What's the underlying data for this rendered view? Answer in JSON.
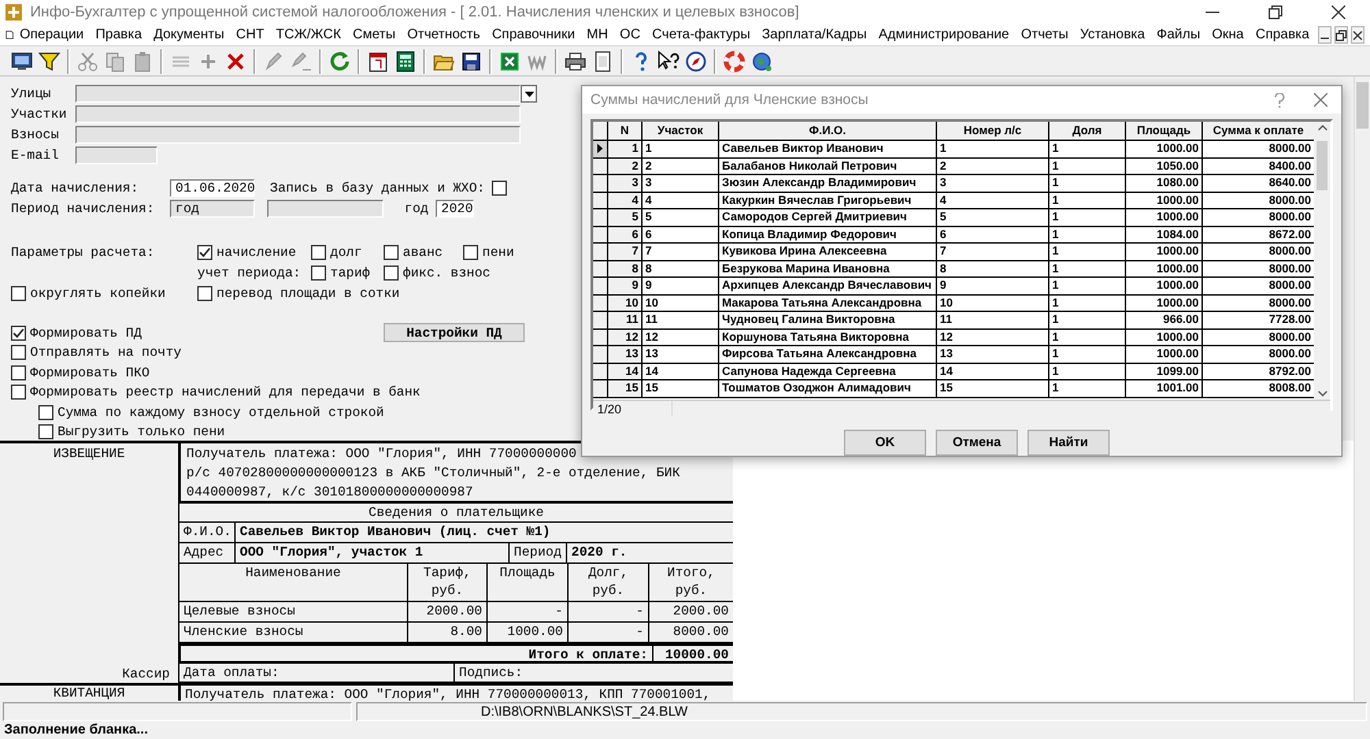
{
  "window": {
    "title": "Инфо-Бухгалтер с упрощенной системой налогообложения - [ 2.01. Начисления членских и целевых взносов]"
  },
  "menu": [
    "Операции",
    "Правка",
    "Документы",
    "СНТ",
    "ТСЖ/ЖСК",
    "Сметы",
    "Отчетность",
    "Справочники",
    "МН",
    "ОС",
    "Счета-фактуры",
    "Зарплата/Кадры",
    "Администрирование",
    "Отчеты",
    "Установка",
    "Файлы",
    "Окна",
    "Справка"
  ],
  "form": {
    "fields": [
      {
        "label": "Улицы",
        "kind": "combo"
      },
      {
        "label": "Участки",
        "kind": "text"
      },
      {
        "label": "Взносы",
        "kind": "text"
      },
      {
        "label": "E-mail",
        "kind": "short"
      }
    ],
    "accrual_date": {
      "label": "Дата начисления:",
      "value": "01.06.2020"
    },
    "db_write": {
      "label": "Запись в базу данных и ЖХО:",
      "checked": false
    },
    "period": {
      "label": "Период начисления:",
      "value": "год",
      "year_label": "год",
      "year": "2020"
    },
    "params_label": "Параметры расчета:",
    "params": [
      {
        "label": "начисление",
        "checked": true
      },
      {
        "label": "долг",
        "checked": false
      },
      {
        "label": "аванс",
        "checked": false
      },
      {
        "label": "пени",
        "checked": false
      }
    ],
    "period_account_label": "учет периода:",
    "period_account": [
      {
        "label": "тариф",
        "checked": false
      },
      {
        "label": "фикс. взнос",
        "checked": false
      }
    ],
    "extras": [
      {
        "label": "округлять копейки",
        "checked": false
      },
      {
        "label": "перевод площади в сотки",
        "checked": false
      }
    ],
    "options": [
      {
        "label": "Формировать ПД",
        "checked": true
      },
      {
        "label": "Отправлять на почту",
        "checked": false
      },
      {
        "label": "Формировать ПКО",
        "checked": false
      },
      {
        "label": "Формировать реестр начислений для передачи в банк",
        "checked": false,
        "children": [
          {
            "label": "Сумма по каждому взносу отдельной строкой",
            "checked": false
          },
          {
            "label": "Выгрузить только пени",
            "checked": false
          }
        ]
      }
    ],
    "settings_button": "Настройки ПД"
  },
  "document": {
    "notice_label": "ИЗВЕЩЕНИЕ",
    "recipient_lines": [
      "Получатель платежа: ООО \"Глория\", ИНН 77000000000",
      "р/с 40702800000000000123 в АКБ \"Столичный\", 2-е отделение, БИК",
      "0440000987, к/с 30101800000000000987"
    ],
    "payer_heading": "Сведения о плательщике",
    "fio_label": "Ф.И.О.",
    "fio": "Савельев Виктор Иванович (лиц. счет №1)",
    "address_label": "Адрес",
    "address": "ООО \"Глория\", участок 1",
    "period_label": "Период",
    "period": "2020 г.",
    "columns": [
      "Наименование",
      "Тариф, руб.",
      "Площадь",
      "Долг, руб.",
      "Итого, руб."
    ],
    "rows": [
      [
        "Целевые взносы",
        "2000.00",
        "-",
        "-",
        "2000.00"
      ],
      [
        "Членские взносы",
        "8.00",
        "1000.00",
        "-",
        "8000.00"
      ]
    ],
    "total_label": "Итого к оплате:",
    "total": "10000.00",
    "cashier_label": "Кассир",
    "payment_date_label": "Дата оплаты:",
    "signature_label": "Подпись:",
    "receipt_label": "КВИТАНЦИЯ",
    "receipt_recipient": "Получатель платежа: ООО \"Глория\", ИНН 770000000013, КПП 770001001,"
  },
  "status": {
    "path": "D:\\IB8\\ORN\\BLANKS\\ST_24.BLW",
    "message": "Заполнение бланка..."
  },
  "dialog": {
    "title": "Суммы начислений для Членские взносы",
    "columns": [
      "N",
      "Участок",
      "Ф.И.О.",
      "Номер л/с",
      "Доля",
      "Площадь",
      "Сумма к оплате"
    ],
    "rows": [
      {
        "selected": true,
        "cells": [
          "1",
          "1",
          "Савельев Виктор Иванович",
          "1",
          "1",
          "1000.00",
          "8000.00"
        ]
      },
      {
        "selected": false,
        "cells": [
          "2",
          "2",
          "Балабанов Николай Петрович",
          "2",
          "1",
          "1050.00",
          "8400.00"
        ]
      },
      {
        "selected": false,
        "cells": [
          "3",
          "3",
          "Зюзин Александр Владимирович",
          "3",
          "1",
          "1080.00",
          "8640.00"
        ]
      },
      {
        "selected": false,
        "cells": [
          "4",
          "4",
          "Какуркин Вячеслав Григорьевич",
          "4",
          "1",
          "1000.00",
          "8000.00"
        ]
      },
      {
        "selected": false,
        "cells": [
          "5",
          "5",
          "Самородов Сергей Дмитриевич",
          "5",
          "1",
          "1000.00",
          "8000.00"
        ]
      },
      {
        "selected": false,
        "cells": [
          "6",
          "6",
          "Копица Владимир Федорович",
          "6",
          "1",
          "1084.00",
          "8672.00"
        ]
      },
      {
        "selected": false,
        "cells": [
          "7",
          "7",
          "Кувикова Ирина Алексеевна",
          "7",
          "1",
          "1000.00",
          "8000.00"
        ]
      },
      {
        "selected": false,
        "cells": [
          "8",
          "8",
          "Безрукова Марина Ивановна",
          "8",
          "1",
          "1000.00",
          "8000.00"
        ]
      },
      {
        "selected": false,
        "cells": [
          "9",
          "9",
          "Архипцев Александр Вячеславович",
          "9",
          "1",
          "1000.00",
          "8000.00"
        ]
      },
      {
        "selected": false,
        "cells": [
          "10",
          "10",
          "Макарова Татьяна Александровна",
          "10",
          "1",
          "1000.00",
          "8000.00"
        ]
      },
      {
        "selected": false,
        "cells": [
          "11",
          "11",
          "Чудновец Галина Викторовна",
          "11",
          "1",
          "966.00",
          "7728.00"
        ]
      },
      {
        "selected": false,
        "cells": [
          "12",
          "12",
          "Коршунова Татьяна Викторовна",
          "12",
          "1",
          "1000.00",
          "8000.00"
        ]
      },
      {
        "selected": false,
        "cells": [
          "13",
          "13",
          "Фирсова Татьяна Александровна",
          "13",
          "1",
          "1000.00",
          "8000.00"
        ]
      },
      {
        "selected": false,
        "cells": [
          "14",
          "14",
          "Сапунова Надежда Сергеевна",
          "14",
          "1",
          "1099.00",
          "8792.00"
        ]
      },
      {
        "selected": false,
        "cells": [
          "15",
          "15",
          "Тошматов Озоджон Алимадович",
          "15",
          "1",
          "1001.00",
          "8008.00"
        ]
      }
    ],
    "counter": "1/20",
    "buttons": [
      "OK",
      "Отмена",
      "Найти"
    ]
  }
}
